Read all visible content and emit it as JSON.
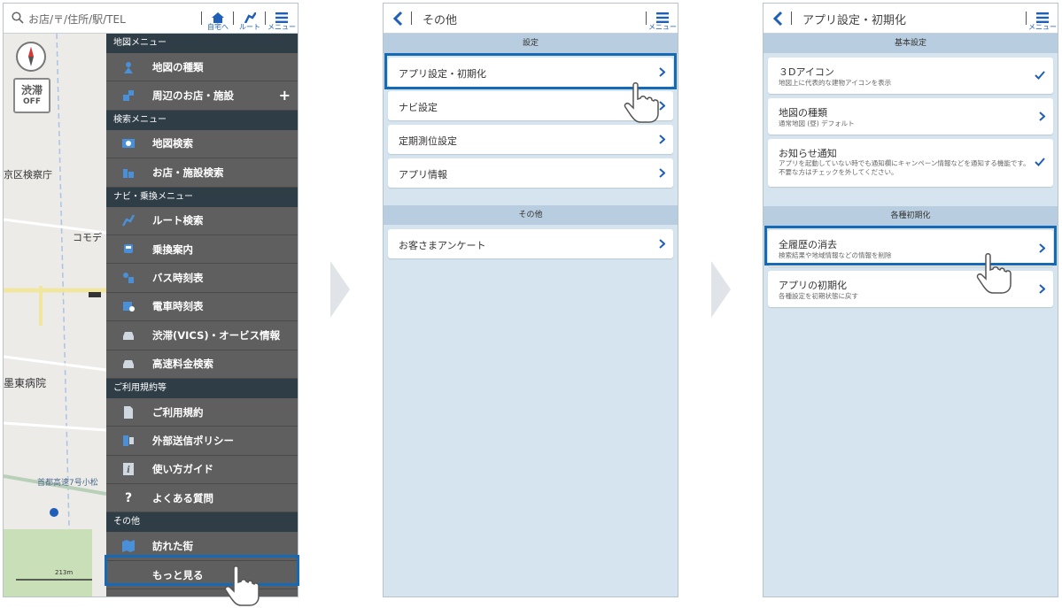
{
  "screen1": {
    "search": {
      "placeholder": "お店/〒/住所/駅/TEL"
    },
    "toolbar": {
      "home": "自宅へ",
      "route": "ルート",
      "menu": "メニュー"
    },
    "map": {
      "jam_line1": "渋滞",
      "jam_line2": "OFF",
      "labels": [
        "京区検察庁",
        "コモデ",
        "墨東病院",
        "首都高速7号小松"
      ],
      "scale": "213m"
    },
    "menu": {
      "sections": [
        {
          "header": "地図メニュー",
          "items": [
            "地図の種類",
            "周辺のお店・施設"
          ]
        },
        {
          "header": "検索メニュー",
          "items": [
            "地図検索",
            "お店・施設検索"
          ]
        },
        {
          "header": "ナビ・乗換メニュー",
          "items": [
            "ルート検索",
            "乗換案内",
            "バス時刻表",
            "電車時刻表",
            "渋滞(VICS)・オービス情報",
            "高速料金検索"
          ]
        },
        {
          "header": "ご利用規約等",
          "items": [
            "ご利用規約",
            "外部送信ポリシー",
            "使い方ガイド",
            "よくある質問"
          ]
        },
        {
          "header": "その他",
          "items": [
            "訪れた街",
            "もっと見る"
          ]
        }
      ]
    }
  },
  "screen2": {
    "title": "その他",
    "menu_caption": "メニュー",
    "sections": [
      {
        "header": "設定",
        "items": [
          "アプリ設定・初期化",
          "ナビ設定",
          "定期測位設定",
          "アプリ情報"
        ]
      },
      {
        "header": "その他",
        "items": [
          "お客さまアンケート"
        ]
      }
    ]
  },
  "screen3": {
    "title": "アプリ設定・初期化",
    "menu_caption": "メニュー",
    "basic_header": "基本設定",
    "basic_items": [
      {
        "label": "３Dアイコン",
        "sub": "地図上に代表的な建物アイコンを表示",
        "control": "check"
      },
      {
        "label": "地図の種類",
        "sub": "通常地図 (昼) デフォルト",
        "control": "chevron"
      },
      {
        "label": "お知らせ通知",
        "sub": "アプリを起動していない時でも通知欄にキャンペーン情報などを通知する機能です。不要な方はチェックを外してください。",
        "control": "check"
      }
    ],
    "reset_header": "各種初期化",
    "reset_items": [
      {
        "label": "全履歴の消去",
        "sub": "検索結果や地域情報などの情報を削除"
      },
      {
        "label": "アプリの初期化",
        "sub": "各種設定を初期状態に戻す"
      }
    ]
  },
  "colors": {
    "accent": "#1669b5",
    "menu_bg": "#5f5f5f",
    "section_bg": "#2f3d47",
    "list_bg": "#d5e4ee"
  }
}
